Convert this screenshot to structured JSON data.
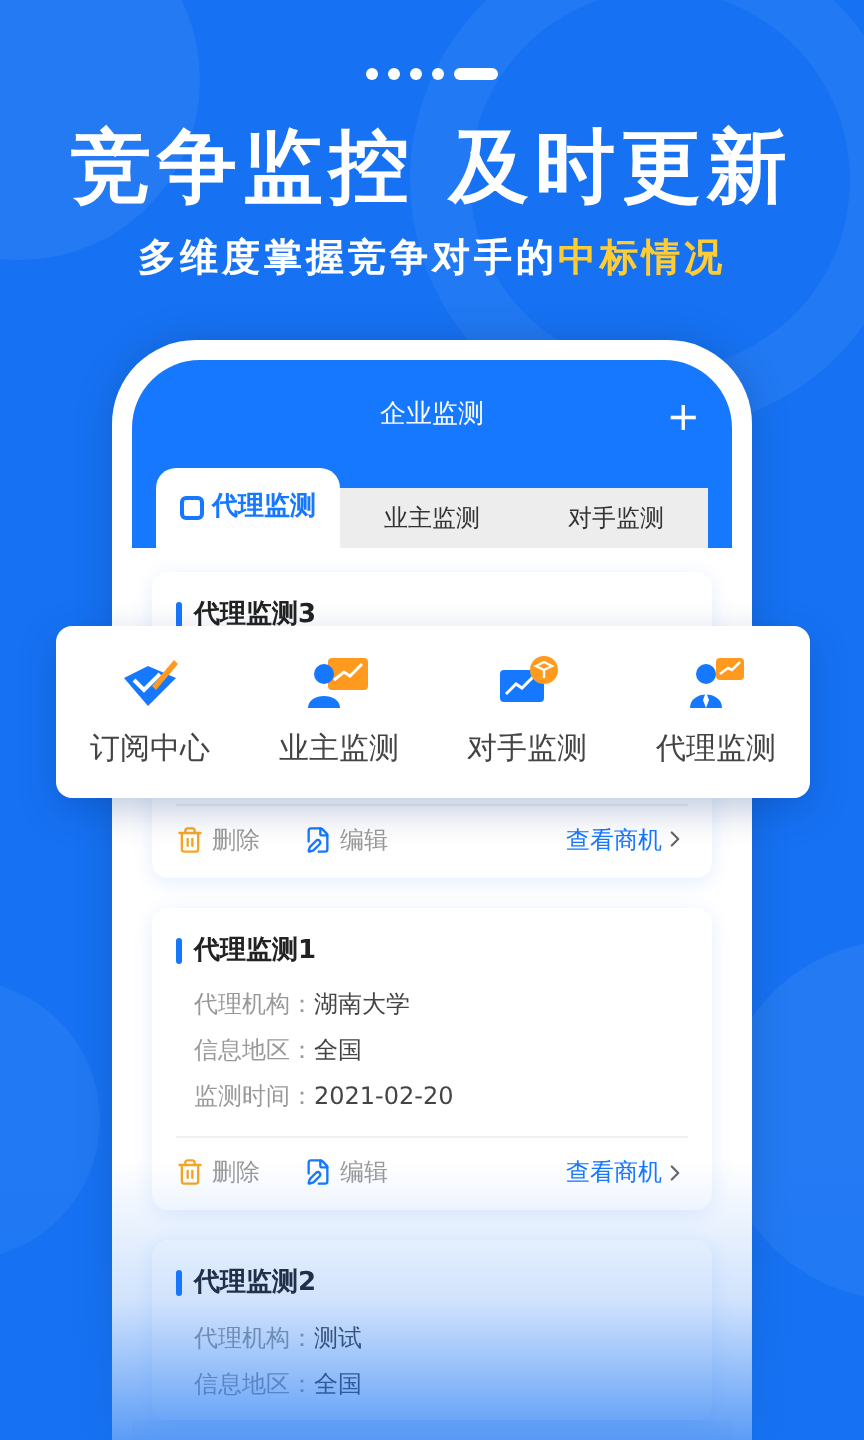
{
  "pager": [
    {
      "selected": false
    },
    {
      "selected": false
    },
    {
      "selected": false
    },
    {
      "selected": false
    },
    {
      "selected": true
    }
  ],
  "headline": "竞争监控 及时更新",
  "subtitle": {
    "text": "多维度掌握竞争对手的",
    "highlight": "中标情况"
  },
  "phone": {
    "title": "企业监测",
    "add": "+",
    "tabs": [
      {
        "label": "代理监测",
        "selected": true
      },
      {
        "label": "业主监测",
        "selected": false
      },
      {
        "label": "对手监测",
        "selected": false
      }
    ],
    "cards": [
      {
        "title": "代理监测3",
        "delete": "删除",
        "edit": "编辑",
        "link": "查看商机"
      },
      {
        "title": "代理监测1",
        "fields": [
          {
            "label": "代理机构：",
            "value": "湖南大学"
          },
          {
            "label": "信息地区：",
            "value": "全国"
          },
          {
            "label": "监测时间：",
            "value": "2021-02-20"
          }
        ],
        "delete": "删除",
        "edit": "编辑",
        "link": "查看商机"
      },
      {
        "title": "代理监测2",
        "fields": [
          {
            "label": "代理机构：",
            "value": "测试"
          },
          {
            "label": "信息地区：",
            "value": "全国"
          }
        ]
      }
    ]
  },
  "quick_menu": [
    {
      "kind": "subscribe",
      "label": "订阅中心"
    },
    {
      "kind": "owner",
      "label": "业主监测"
    },
    {
      "kind": "rival",
      "label": "对手监测"
    },
    {
      "kind": "agent",
      "label": "代理监测"
    }
  ]
}
